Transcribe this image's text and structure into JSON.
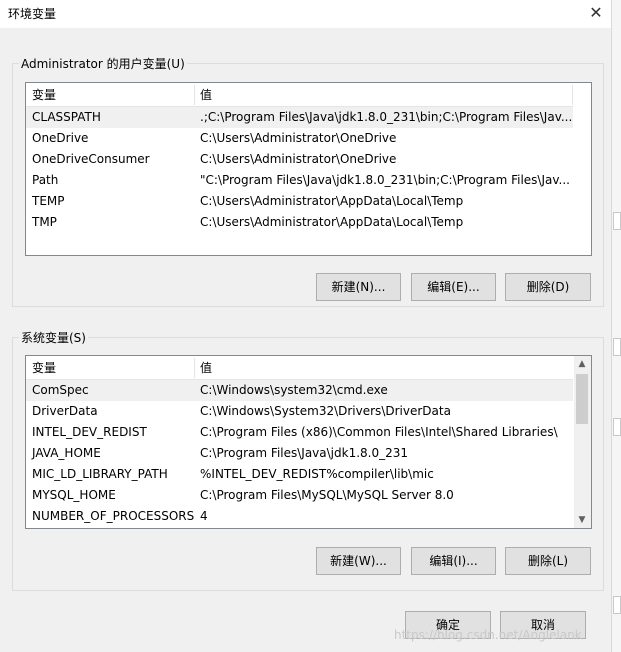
{
  "window": {
    "title": "环境变量"
  },
  "user_vars": {
    "group_label": "Administrator 的用户变量(U)",
    "columns": [
      "变量",
      "值"
    ],
    "rows": [
      {
        "name": "CLASSPATH",
        "value": ".;C:\\Program Files\\Java\\jdk1.8.0_231\\bin;C:\\Program Files\\Jav..."
      },
      {
        "name": "OneDrive",
        "value": "C:\\Users\\Administrator\\OneDrive"
      },
      {
        "name": "OneDriveConsumer",
        "value": "C:\\Users\\Administrator\\OneDrive"
      },
      {
        "name": "Path",
        "value": "\"C:\\Program Files\\Java\\jdk1.8.0_231\\bin;C:\\Program Files\\Jav..."
      },
      {
        "name": "TEMP",
        "value": "C:\\Users\\Administrator\\AppData\\Local\\Temp"
      },
      {
        "name": "TMP",
        "value": "C:\\Users\\Administrator\\AppData\\Local\\Temp"
      }
    ],
    "buttons": {
      "new": "新建(N)...",
      "edit": "编辑(E)...",
      "delete": "删除(D)"
    }
  },
  "system_vars": {
    "group_label": "系统变量(S)",
    "columns": [
      "变量",
      "值"
    ],
    "rows": [
      {
        "name": "ComSpec",
        "value": "C:\\Windows\\system32\\cmd.exe"
      },
      {
        "name": "DriverData",
        "value": "C:\\Windows\\System32\\Drivers\\DriverData"
      },
      {
        "name": "INTEL_DEV_REDIST",
        "value": "C:\\Program Files (x86)\\Common Files\\Intel\\Shared Libraries\\"
      },
      {
        "name": "JAVA_HOME",
        "value": "C:\\Program Files\\Java\\jdk1.8.0_231"
      },
      {
        "name": "MIC_LD_LIBRARY_PATH",
        "value": "%INTEL_DEV_REDIST%compiler\\lib\\mic"
      },
      {
        "name": "MYSQL_HOME",
        "value": "C:\\Program Files\\MySQL\\MySQL Server 8.0"
      },
      {
        "name": "NUMBER_OF_PROCESSORS",
        "value": "4"
      }
    ],
    "buttons": {
      "new": "新建(W)...",
      "edit": "编辑(I)...",
      "delete": "删除(L)"
    }
  },
  "footer": {
    "ok": "确定",
    "cancel": "取消"
  },
  "watermark": "https://blog.csdn.net/Anglelank",
  "icons": {
    "close": "close-icon",
    "scroll_up": "chevron-up-icon",
    "scroll_down": "chevron-down-icon"
  }
}
